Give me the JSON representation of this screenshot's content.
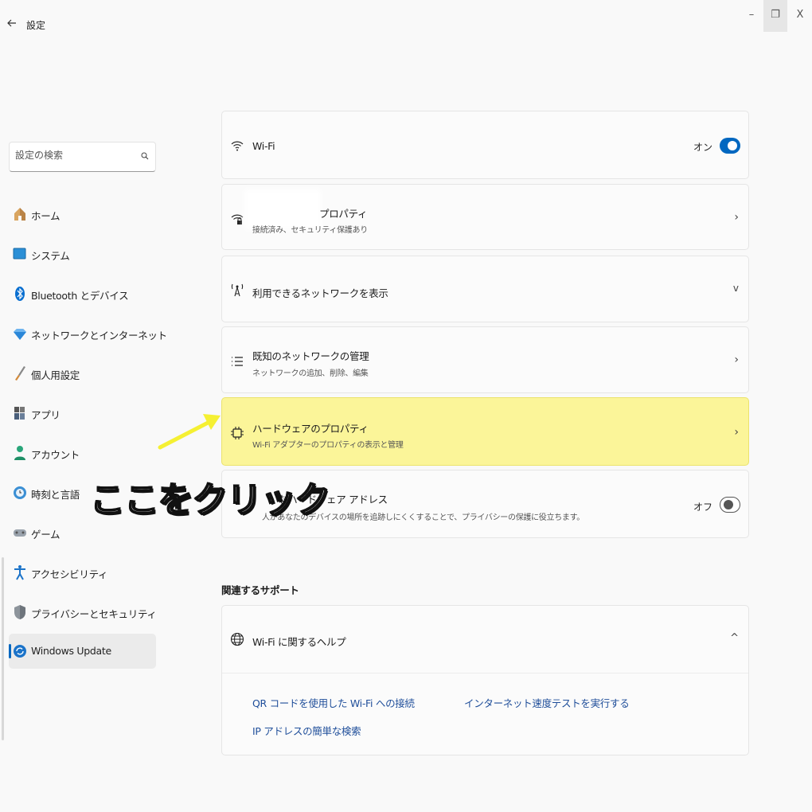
{
  "window": {
    "title": "設定",
    "minimize": "–",
    "maximize": "❐",
    "close": "X"
  },
  "search": {
    "placeholder": "設定の検索"
  },
  "sidebar": {
    "items": [
      {
        "label": "ホーム",
        "icon": "home-icon"
      },
      {
        "label": "システム",
        "icon": "system-icon"
      },
      {
        "label": "Bluetooth とデバイス",
        "icon": "bluetooth-icon"
      },
      {
        "label": "ネットワークとインターネット",
        "icon": "network-icon"
      },
      {
        "label": "個人用設定",
        "icon": "brush-icon"
      },
      {
        "label": "アプリ",
        "icon": "apps-icon"
      },
      {
        "label": "アカウント",
        "icon": "account-icon"
      },
      {
        "label": "時刻と言語",
        "icon": "time-language-icon"
      },
      {
        "label": "ゲーム",
        "icon": "gamepad-icon"
      },
      {
        "label": "アクセシビリティ",
        "icon": "accessibility-icon"
      },
      {
        "label": "プライバシーとセキュリティ",
        "icon": "shield-icon"
      },
      {
        "label": "Windows Update",
        "icon": "windows-update-icon",
        "selected": true
      }
    ]
  },
  "main": {
    "wifi": {
      "title": "Wi-Fi",
      "toggle_label": "オン",
      "toggle_on": true
    },
    "properties": {
      "title": "プロパティ",
      "subtitle": "接続済み、セキュリティ保護あり"
    },
    "available": {
      "title": "利用できるネットワークを表示"
    },
    "known": {
      "title": "既知のネットワークの管理",
      "subtitle": "ネットワークの追加、削除、編集"
    },
    "hardware": {
      "title": "ハードウェアのプロパティ",
      "subtitle": "Wi-Fi アダプターのプロパティの表示と管理"
    },
    "random": {
      "title": "なハードウェア アドレス",
      "subtitle": "人があなたのデバイスの場所を追跡しにくくすることで、プライバシーの保護に役立ちます。",
      "toggle_label": "オフ",
      "toggle_on": false
    },
    "related_heading": "関連するサポート",
    "help": {
      "title": "Wi-Fi に関するヘルプ",
      "links": [
        "QR コードを使用した Wi-Fi への接続",
        "インターネット速度テストを実行する",
        "IP アドレスの簡単な検索"
      ]
    }
  },
  "annotation": {
    "text": "ここをクリック",
    "color": "#f5f033"
  },
  "colors": {
    "accent": "#0067c0",
    "highlight": "#fbf599",
    "link": "#1f4e9a"
  }
}
